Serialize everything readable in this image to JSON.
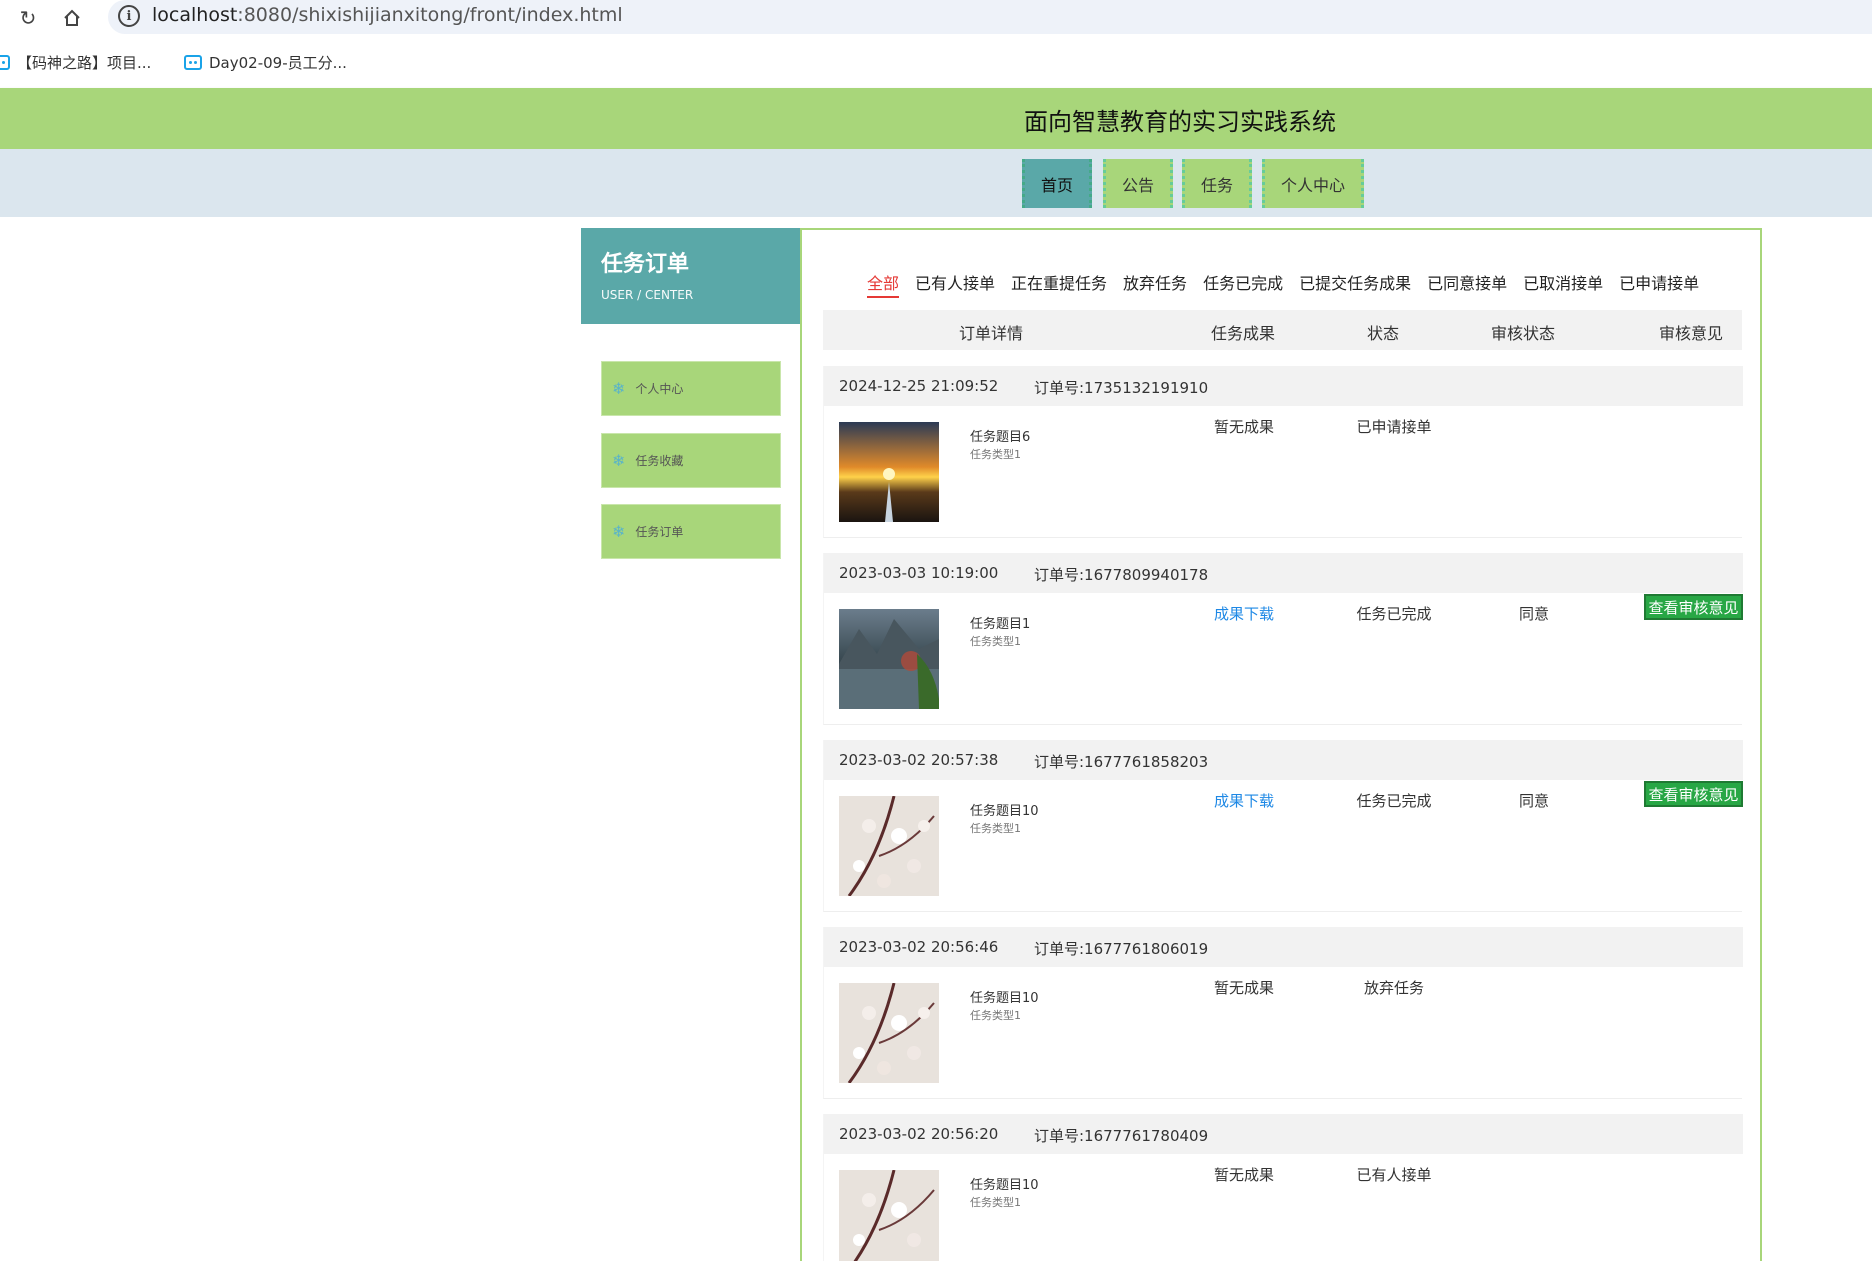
{
  "browser": {
    "url_host": "localhost",
    "url_path": ":8080/shixishijianxitong/front/index.html",
    "bookmarks": [
      "【码神之路】项目...",
      "Day02-09-员工分..."
    ]
  },
  "site": {
    "title": "面向智慧教育的实习实践系统",
    "nav": [
      "首页",
      "公告",
      "任务",
      "个人中心"
    ]
  },
  "sidebar": {
    "title": "任务订单",
    "subtitle": "USER / CENTER",
    "items": [
      "个人中心",
      "任务收藏",
      "任务订单"
    ]
  },
  "tabs": [
    "全部",
    "已有人接单",
    "正在重提任务",
    "放弃任务",
    "任务已完成",
    "已提交任务成果",
    "已同意接单",
    "已取消接单",
    "已申请接单"
  ],
  "columns": [
    "订单详情",
    "任务成果",
    "状态",
    "审核状态",
    "审核意见"
  ],
  "orders": [
    {
      "time": "2024-12-25 21:09:52",
      "order_no": "订单号:1735132191910",
      "title": "任务题目6",
      "type": "任务类型1",
      "result": "暂无成果",
      "status": "已申请接单",
      "audit": "",
      "opinion": ""
    },
    {
      "time": "2023-03-03 10:19:00",
      "order_no": "订单号:1677809940178",
      "title": "任务题目1",
      "type": "任务类型1",
      "result": "成果下载",
      "status": "任务已完成",
      "audit": "同意",
      "opinion": "查看审核意见"
    },
    {
      "time": "2023-03-02 20:57:38",
      "order_no": "订单号:1677761858203",
      "title": "任务题目10",
      "type": "任务类型1",
      "result": "成果下载",
      "status": "任务已完成",
      "audit": "同意",
      "opinion": "查看审核意见"
    },
    {
      "time": "2023-03-02 20:56:46",
      "order_no": "订单号:1677761806019",
      "title": "任务题目10",
      "type": "任务类型1",
      "result": "暂无成果",
      "status": "放弃任务",
      "audit": "",
      "opinion": ""
    },
    {
      "time": "2023-03-02 20:56:20",
      "order_no": "订单号:1677761780409",
      "title": "任务题目10",
      "type": "任务类型1",
      "result": "暂无成果",
      "status": "已有人接单",
      "audit": "",
      "opinion": ""
    }
  ]
}
